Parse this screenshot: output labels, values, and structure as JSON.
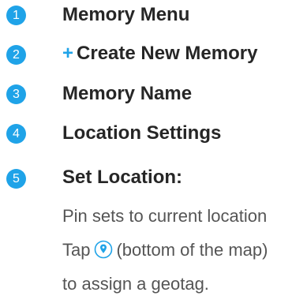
{
  "accent_color": "#1fa3e8",
  "steps": [
    {
      "number": "1",
      "label": "Memory Menu"
    },
    {
      "number": "2",
      "label": "Create New Memory",
      "icon": "plus-icon"
    },
    {
      "number": "3",
      "label": "Memory Name"
    },
    {
      "number": "4",
      "label": "Location Settings"
    },
    {
      "number": "5",
      "label": "Set Location:"
    }
  ],
  "set_location": {
    "line1": "Pin sets to current location",
    "line2_before": "Tap",
    "line2_after": "(bottom of the map)",
    "line3": "to assign a geotag.",
    "icon": "location-pin-icon"
  }
}
